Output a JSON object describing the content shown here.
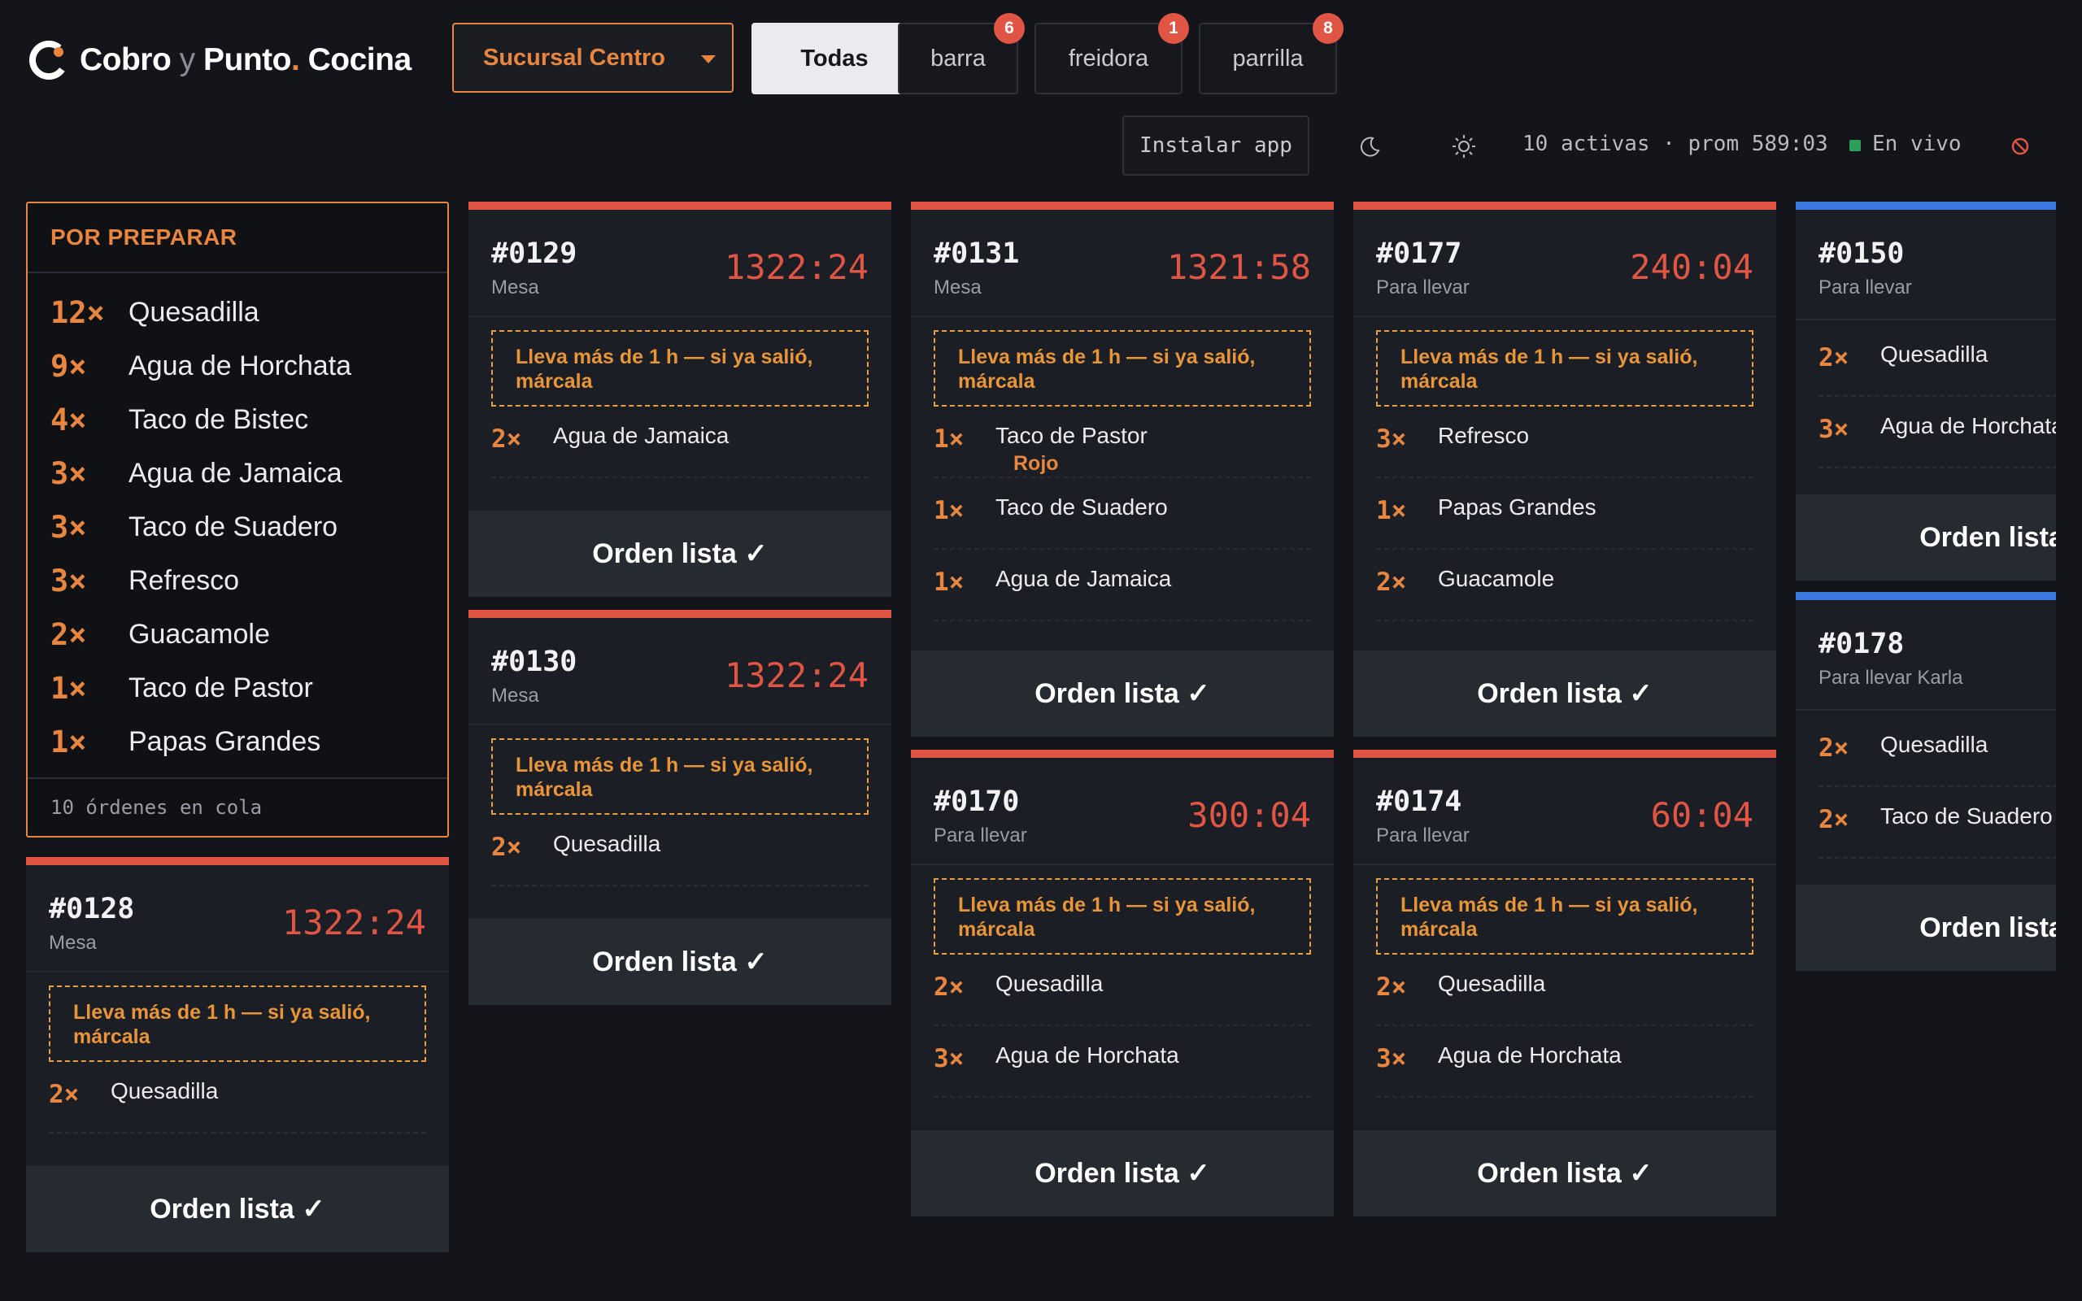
{
  "brand": {
    "part1": "Cobro",
    "part2": " y ",
    "part3": "Punto",
    "part4": ".",
    "part5": " Cocina"
  },
  "branch": {
    "selected": "Sucursal Centro"
  },
  "tabs": [
    {
      "label": "Todas",
      "badge": null
    },
    {
      "label": "barra",
      "badge": "6"
    },
    {
      "label": "freidora",
      "badge": "1"
    },
    {
      "label": "parrilla",
      "badge": "8"
    }
  ],
  "toolbar": {
    "install": "Instalar app",
    "status": "10 activas · prom 589:03",
    "live": "En vivo"
  },
  "icons": {
    "theme_dark": "moon-icon",
    "theme_light": "sun-icon",
    "offline": "no-signal-icon"
  },
  "colors": {
    "accent": "#e8853f",
    "danger": "#e05543",
    "info": "#3a7ae0",
    "live": "#2e9f58"
  },
  "summary": {
    "title": "POR PREPARAR",
    "items": [
      {
        "qty": "12×",
        "name": "Quesadilla"
      },
      {
        "qty": "9×",
        "name": "Agua de Horchata"
      },
      {
        "qty": "4×",
        "name": "Taco de Bistec"
      },
      {
        "qty": "3×",
        "name": "Agua de Jamaica"
      },
      {
        "qty": "3×",
        "name": "Taco de Suadero"
      },
      {
        "qty": "3×",
        "name": "Refresco"
      },
      {
        "qty": "2×",
        "name": "Guacamole"
      },
      {
        "qty": "1×",
        "name": "Taco de Pastor"
      },
      {
        "qty": "1×",
        "name": "Papas Grandes"
      }
    ],
    "footer": "10 órdenes en cola"
  },
  "warning": "Lleva más de 1 h — si ya salió, márcala",
  "ready_label": "Orden lista ✓",
  "orders": [
    {
      "num": "#0128",
      "type": "Mesa",
      "time": "1322:24",
      "items": [
        {
          "qty": "2×",
          "name": "Quesadilla"
        }
      ]
    },
    {
      "num": "#0129",
      "type": "Mesa",
      "time": "1322:24",
      "items": [
        {
          "qty": "2×",
          "name": "Agua de Jamaica"
        }
      ]
    },
    {
      "num": "#0130",
      "type": "Mesa",
      "time": "1322:24",
      "items": [
        {
          "qty": "2×",
          "name": "Quesadilla"
        }
      ]
    },
    {
      "num": "#0131",
      "type": "Mesa",
      "time": "1321:58",
      "items": [
        {
          "qty": "1×",
          "name": "Taco de Pastor",
          "note": "Rojo"
        },
        {
          "qty": "1×",
          "name": "Taco de Suadero"
        },
        {
          "qty": "1×",
          "name": "Agua de Jamaica"
        }
      ]
    },
    {
      "num": "#0170",
      "type": "Para llevar",
      "time": "300:04",
      "items": [
        {
          "qty": "2×",
          "name": "Quesadilla"
        },
        {
          "qty": "3×",
          "name": "Agua de Horchata"
        }
      ]
    },
    {
      "num": "#0177",
      "type": "Para llevar",
      "time": "240:04",
      "items": [
        {
          "qty": "3×",
          "name": "Refresco"
        },
        {
          "qty": "1×",
          "name": "Papas Grandes"
        },
        {
          "qty": "2×",
          "name": "Guacamole"
        }
      ]
    },
    {
      "num": "#0174",
      "type": "Para llevar",
      "time": "60:04",
      "items": [
        {
          "qty": "2×",
          "name": "Quesadilla"
        },
        {
          "qty": "3×",
          "name": "Agua de Horchata"
        }
      ]
    },
    {
      "num": "#0150",
      "type": "Para llevar",
      "time": "",
      "items": [
        {
          "qty": "2×",
          "name": "Quesadilla"
        },
        {
          "qty": "3×",
          "name": "Agua de Horchata"
        }
      ]
    },
    {
      "num": "#0178",
      "type": "Para llevar Karla",
      "time": "",
      "items": [
        {
          "qty": "2×",
          "name": "Quesadilla"
        },
        {
          "qty": "2×",
          "name": "Taco de Suadero"
        }
      ]
    }
  ]
}
